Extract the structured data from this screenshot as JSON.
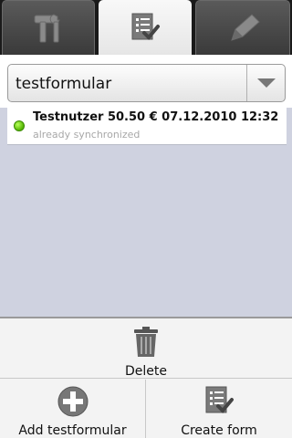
{
  "tabs": [
    {
      "icon": "tools-icon",
      "active": false
    },
    {
      "icon": "checklist-icon",
      "active": true
    },
    {
      "icon": "pencil-icon",
      "active": false
    }
  ],
  "form_selector": {
    "selected": "testformular",
    "dropdown_icon": "chevron-down-icon"
  },
  "entries": [
    {
      "title": "Testnutzer 50.50 € 07.12.2010 12:32",
      "status": "already synchronized",
      "status_color": "#52b300"
    }
  ],
  "menu": {
    "delete_label": "Delete",
    "add_label": "Add testformular",
    "create_label": "Create form"
  },
  "colors": {
    "background": "#cfd2e0",
    "tab_dark": "#3a3a3a",
    "tab_active": "#f0f0f0"
  }
}
